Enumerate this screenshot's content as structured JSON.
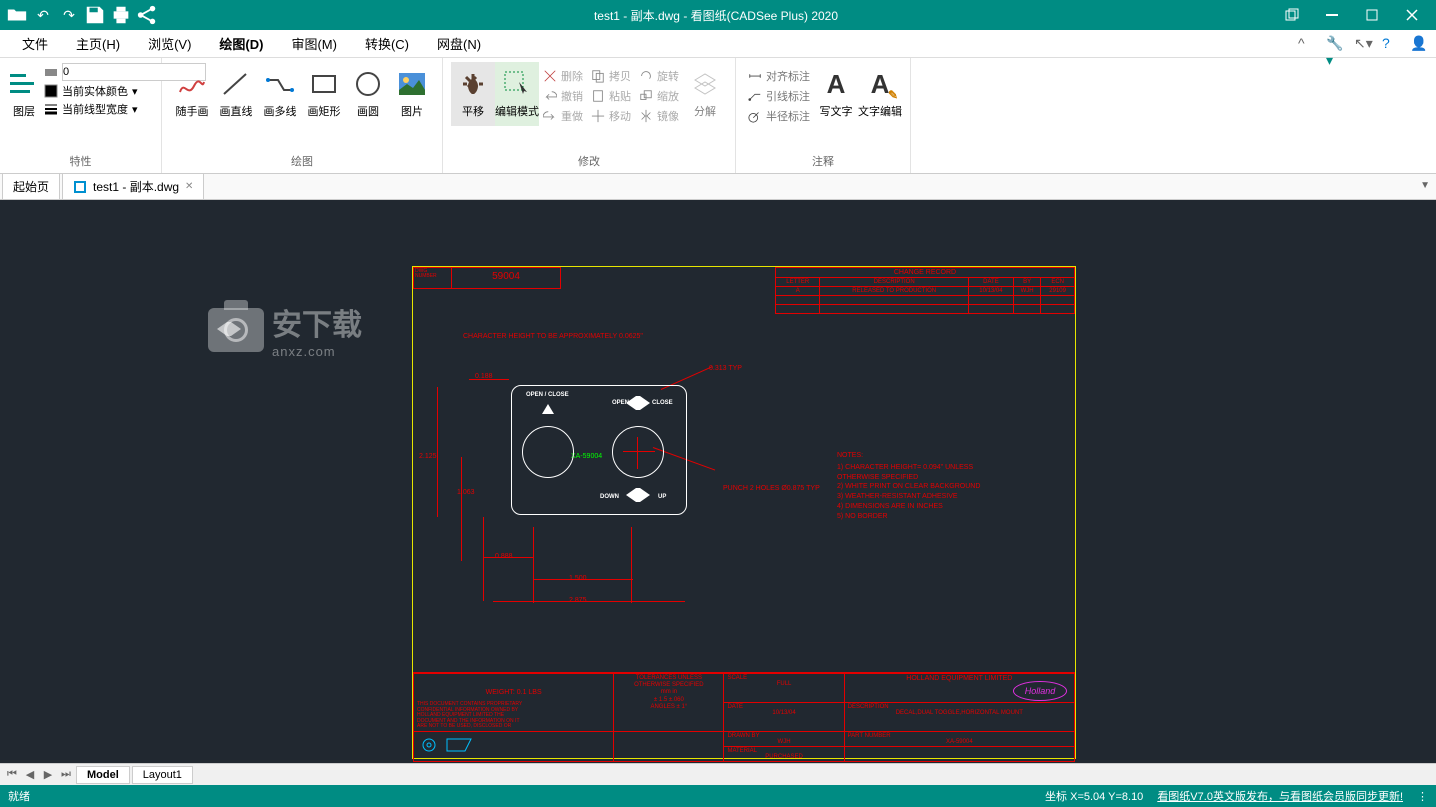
{
  "title": "test1 - 副本.dwg - 看图纸(CADSee Plus) 2020",
  "menus": {
    "file": "文件",
    "home": "主页(H)",
    "view": "浏览(V)",
    "draw": "绘图(D)",
    "review": "审图(M)",
    "convert": "转换(C)",
    "cloud": "网盘(N)"
  },
  "ribbon": {
    "layer_label": "图层",
    "layer_value": "0",
    "entity_color": "当前实体颜色",
    "linetype": "当前线型宽度",
    "group_props": "特性",
    "freehand": "随手画",
    "line": "画直线",
    "polyline": "画多线",
    "rect": "画矩形",
    "circle": "画圆",
    "image": "图片",
    "group_draw": "绘图",
    "pan": "平移",
    "editmode": "编辑模式",
    "del": "删除",
    "copy": "拷贝",
    "rotate": "旋转",
    "undo": "撤销",
    "paste": "粘贴",
    "scale": "缩放",
    "redo": "重做",
    "move": "移动",
    "mirror": "镜像",
    "explode": "分解",
    "group_modify": "修改",
    "dim_align": "对齐标注",
    "dim_leader": "引线标注",
    "dim_radius": "半径标注",
    "text": "写文字",
    "textedit": "文字编辑",
    "group_annot": "注释"
  },
  "tabs": {
    "start": "起始页",
    "doc": "test1 - 副本.dwg"
  },
  "layout": {
    "model": "Model",
    "layout1": "Layout1"
  },
  "status": {
    "ready": "就绪",
    "coord": "坐标 X=5.04 Y=8.10",
    "link": "看图纸V7.0英文版发布，与看图纸会员版同步更新!"
  },
  "drawing": {
    "dwg_no_lbl": "DWG\nNUMBER",
    "dwg_no": "59004",
    "chg_title": "CHANGE RECORD",
    "chg_hdr": [
      "LETTER",
      "DESCRIPTION",
      "DATE",
      "BY",
      "ECN"
    ],
    "chg_row": [
      "A",
      "RELEASED TO PRODUCTION",
      "10/13/04",
      "WJH",
      "29109"
    ],
    "char_hgt": "CHARACTER HEIGHT\nTO BE APPROXIMATELY\n0.0625\"",
    "d_188": "0.188",
    "d_313": "0.313 TYP",
    "d_2125": "2.125",
    "d_1063": "1.063",
    "d_0888": "0.888",
    "d_1500": "1.500",
    "d_2875": "2.875",
    "punch": "PUNCH 2 HOLES\nØ0.875 TYP",
    "partno": "XA-59004",
    "notes_title": "NOTES:",
    "notes": [
      "1) CHARACTER HEIGHT= 0.094\" UNLESS",
      "   OTHERWISE  SPECIFIED",
      "2) WHITE PRINT ON CLEAR BACKGROUND",
      "3) WEATHER-RESISTANT ADHESIVE",
      "4) DIMENSIONS ARE IN INCHES",
      "5) NO BORDER"
    ],
    "open_close": "OPEN / CLOSE",
    "open": "OPEN",
    "close": "CLOSE",
    "down": "DOWN",
    "up": "UP",
    "weight": "WEIGHT:  0.1 LBS",
    "prop_note": "THIS DOCUMENT CONTAINS PROPRIETARY\nCONFIDENTIAL INFORMATION OWNED BY\nHOLLAND EQUIPMENT LIMITED THE\nDOCUMENT AND THE INFORMATION ON IT\nARE NOT TO BE USED, DISCLOSED OR",
    "tol": "TOLERANCES UNLESS\nOTHERWISE SPECIFIED\nmm      in\n± 1.5   ±.060\nANGLES ± 1°",
    "scale_lbl": "SCALE",
    "scale": "FULL",
    "date_lbl": "DATE",
    "date": "10/13/04",
    "drawn_lbl": "DRAWN BY",
    "drawn": "WJH",
    "mat_lbl": "MATERIAL",
    "mat": "PURCHASED",
    "company": "HOLLAND EQUIPMENT LIMITED",
    "holland": "Holland",
    "desc_lbl": "DESCRIPTION",
    "desc": "DECAL,DUAL TOGGLE,HORIZONTAL MOUNT",
    "pn_lbl": "PART NUMBER",
    "pn": "XA-59004"
  },
  "watermark": "安下载",
  "watermark_sub": "anxz.com"
}
